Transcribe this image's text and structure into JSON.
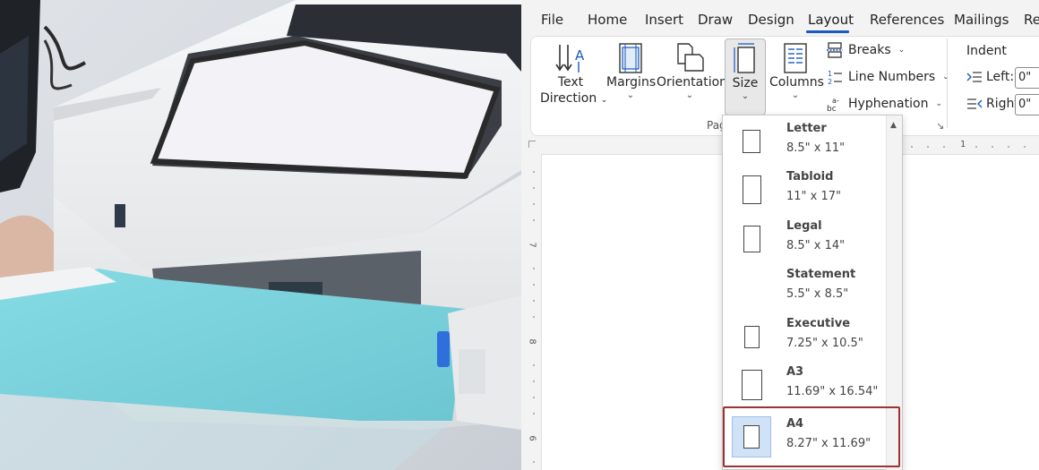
{
  "menu": {
    "tabs": [
      {
        "label": "File"
      },
      {
        "label": "Home"
      },
      {
        "label": "Insert"
      },
      {
        "label": "Draw"
      },
      {
        "label": "Design"
      },
      {
        "label": "Layout"
      },
      {
        "label": "References"
      },
      {
        "label": "Mailings"
      },
      {
        "label": "Re"
      }
    ],
    "active_tab": "Layout"
  },
  "ribbon": {
    "text_direction": {
      "line1": "Text",
      "line2": "Direction"
    },
    "margins": "Margins",
    "orientation": "Orientation",
    "size": "Size",
    "columns": "Columns",
    "breaks": "Breaks",
    "line_numbers": "Line Numbers",
    "hyphenation": "Hyphenation",
    "group_label": "Pag",
    "indent": {
      "title": "Indent",
      "left_label": "Left:",
      "left_value": "0\"",
      "right_label": "Right:",
      "right_value": "0\""
    }
  },
  "ruler": {
    "h_number": "1",
    "v_numbers": [
      "7",
      "8",
      "6"
    ]
  },
  "size_menu": {
    "items": [
      {
        "name": "Letter",
        "dims": "8.5\" x 11\""
      },
      {
        "name": "Tabloid",
        "dims": "11\" x 17\""
      },
      {
        "name": "Legal",
        "dims": "8.5\" x 14\""
      },
      {
        "name": "Statement",
        "dims": "5.5\" x 8.5\""
      },
      {
        "name": "Executive",
        "dims": "7.25\" x 10.5\""
      },
      {
        "name": "A3",
        "dims": "11.69\" x 16.54\""
      },
      {
        "name": "A4",
        "dims": "8.27\" x 11.69\""
      }
    ],
    "selected": "A4"
  },
  "colors": {
    "accent": "#185abd",
    "selection_border": "#9e3232",
    "selection_fill": "#cfe2f6",
    "paper_blue": "#7fd3dd"
  }
}
